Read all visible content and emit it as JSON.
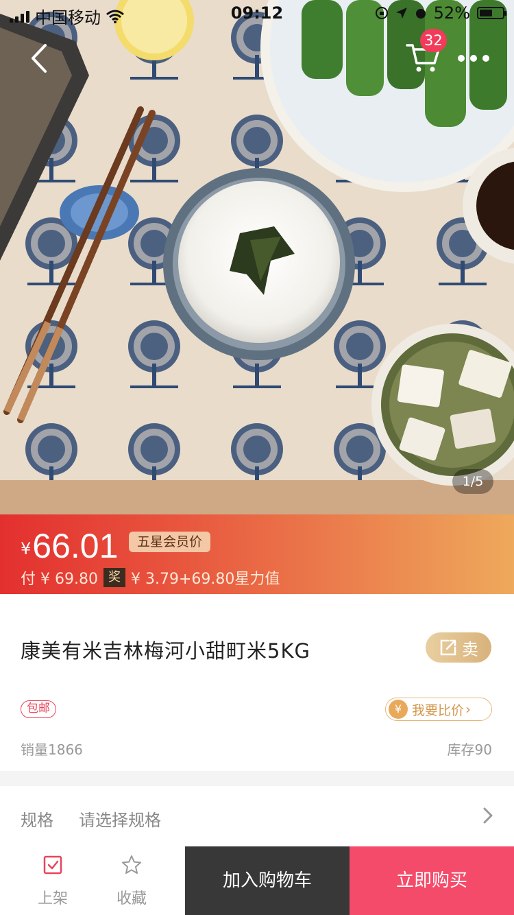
{
  "status_bar": {
    "carrier": "中国移动",
    "time": "09:12",
    "battery": "52%"
  },
  "nav": {
    "cart_count": "32"
  },
  "gallery": {
    "pager": "1/5"
  },
  "price": {
    "currency": "¥",
    "value": "66.01",
    "member_tag": "五星会员价",
    "pay_text": "付 ¥ 69.80",
    "award_label": "奖",
    "reward_text": "¥ 3.79+69.80星力值"
  },
  "product": {
    "title": "康美有米吉林梅河小甜町米5KG",
    "sell_label": "卖",
    "free_shipping": "包邮",
    "compare_icon": "¥",
    "compare_label": "我要比价",
    "sales": "销量1866",
    "stock": "库存90"
  },
  "spec": {
    "label": "规格",
    "value": "请选择规格"
  },
  "bottom_bar": {
    "list_label": "上架",
    "favorite_label": "收藏",
    "add_cart_label": "加入购物车",
    "buy_now_label": "立即购买"
  },
  "colors": {
    "accent_red": "#f54b6a",
    "dark_button": "#383838",
    "price_gradient_start": "#e3302f",
    "price_gradient_end": "#eea95c",
    "gold": "#d8b27b"
  }
}
